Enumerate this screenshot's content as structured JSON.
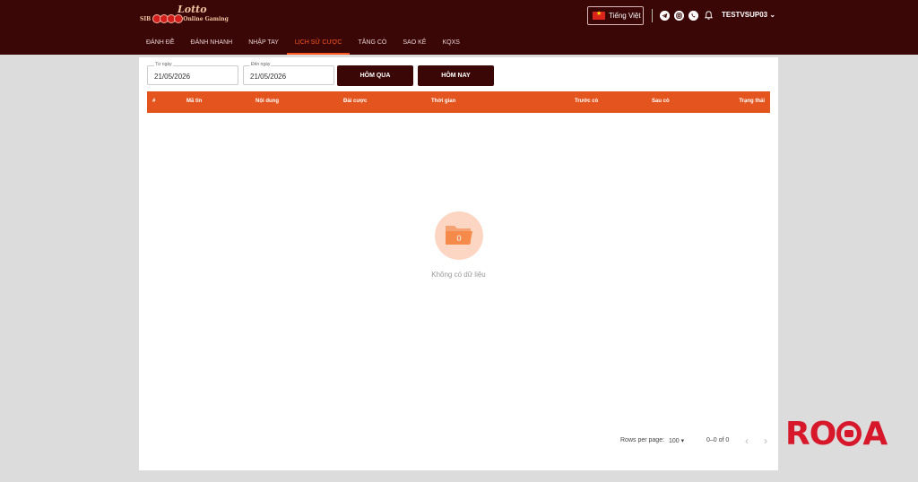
{
  "header": {
    "logo": {
      "top": "Lotto",
      "left": "SIB",
      "right": "Online Gaming"
    },
    "language": "Tiếng Việt",
    "username": "TESTVSUP03",
    "icons": [
      "telegram-icon",
      "instagram-icon",
      "whatsapp-icon",
      "bell-icon"
    ]
  },
  "nav": [
    "ĐÁNH ĐỀ",
    "ĐÁNH NHANH",
    "NHẬP TAY",
    "LỊCH SỬ CƯỢC",
    "TĂNG CÒ",
    "SAO KÊ",
    "KQXS"
  ],
  "nav_active_index": 3,
  "filters": {
    "from_label": "Từ ngày",
    "from_value": "21/05/2026",
    "to_label": "Đến ngày",
    "to_value": "21/05/2026",
    "yesterday_button": "HÔM QUA",
    "today_button": "HÔM NAY"
  },
  "table": {
    "columns": [
      "#",
      "Mã tin",
      "Nội dung",
      "Đài cược",
      "Thời gian",
      "Trước cò",
      "Sau cò",
      "Trạng thái"
    ]
  },
  "empty": {
    "count": "0",
    "message": "Không có dữ liệu"
  },
  "pagination": {
    "rows_label": "Rows per page:",
    "rows_value": "100",
    "range": "0–0 of 0"
  },
  "watermark": {
    "left": "RO",
    "right": "A"
  },
  "colors": {
    "header_bg": "#3a0606",
    "accent": "#ff5722",
    "table_header": "#e3541e"
  }
}
